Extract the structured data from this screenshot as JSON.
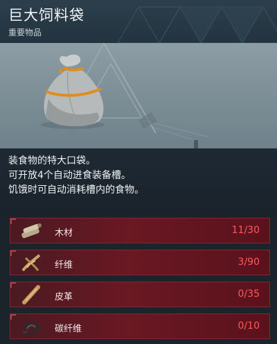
{
  "item": {
    "title": "巨大饲料袋",
    "category": "重要物品",
    "description": [
      "装食物的特大口袋。",
      "可开放4个自动进食装备槽。",
      "饥饿时可自动消耗槽内的食物。"
    ]
  },
  "materials": [
    {
      "name": "木材",
      "count": "11/30",
      "icon": "wood-icon"
    },
    {
      "name": "纤维",
      "count": "3/90",
      "icon": "fiber-icon"
    },
    {
      "name": "皮革",
      "count": "0/35",
      "icon": "leather-icon"
    },
    {
      "name": "碳纤维",
      "count": "0/10",
      "icon": "carbon-fiber-icon"
    }
  ],
  "colors": {
    "insufficient": "#ff5a5a",
    "row_background": "#6a1822",
    "header": "#2c3f4c"
  }
}
